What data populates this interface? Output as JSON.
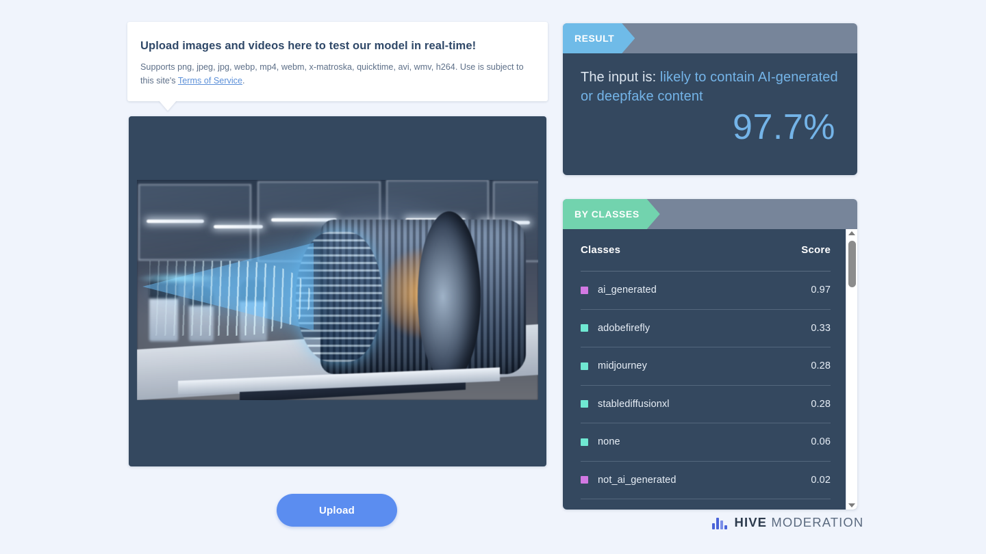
{
  "tooltip": {
    "title": "Upload images and videos here to test our model in real-time!",
    "description_before": "Supports png, jpeg, jpg, webp, mp4, webm, x-matroska, quicktime, avi, wmv, h264. Use is subject to this site's ",
    "link_label": "Terms of Service",
    "description_after": "."
  },
  "preview": {
    "media_alt": "AI-generated image of a glowing blue transparent jet turbine engine model on a bench in a laboratory"
  },
  "upload": {
    "label": "Upload"
  },
  "result": {
    "tag": "RESULT",
    "prefix": "The input is: ",
    "verdict": "likely to contain AI-generated or deepfake content",
    "score": "97.7%"
  },
  "classes": {
    "tag": "BY CLASSES",
    "columns": {
      "name": "Classes",
      "score": "Score"
    },
    "rows": [
      {
        "name": "ai_generated",
        "score": "0.97",
        "color": "#d279e3"
      },
      {
        "name": "adobefirefly",
        "score": "0.33",
        "color": "#6fe8d2"
      },
      {
        "name": "midjourney",
        "score": "0.28",
        "color": "#6fe8d2"
      },
      {
        "name": "stablediffusionxl",
        "score": "0.28",
        "color": "#6fe8d2"
      },
      {
        "name": "none",
        "score": "0.06",
        "color": "#6fe8d2"
      },
      {
        "name": "not_ai_generated",
        "score": "0.02",
        "color": "#d279e3"
      }
    ],
    "scrollbar": {
      "up_icon": "triangle-up-icon",
      "down_icon": "triangle-down-icon"
    }
  },
  "logo": {
    "mark": "hive-bars-icon",
    "brand": "HIVE",
    "product": "MODERATION"
  },
  "colors": {
    "page_background": "#f0f4fc",
    "panel_background": "#34485f",
    "panel_header": "#77859a",
    "result_tag": "#6fbbe8",
    "classes_tag": "#72d3ae",
    "accent_blue": "#74b4e8",
    "upload_button": "#5b8df0",
    "link": "#5b8fd8"
  }
}
